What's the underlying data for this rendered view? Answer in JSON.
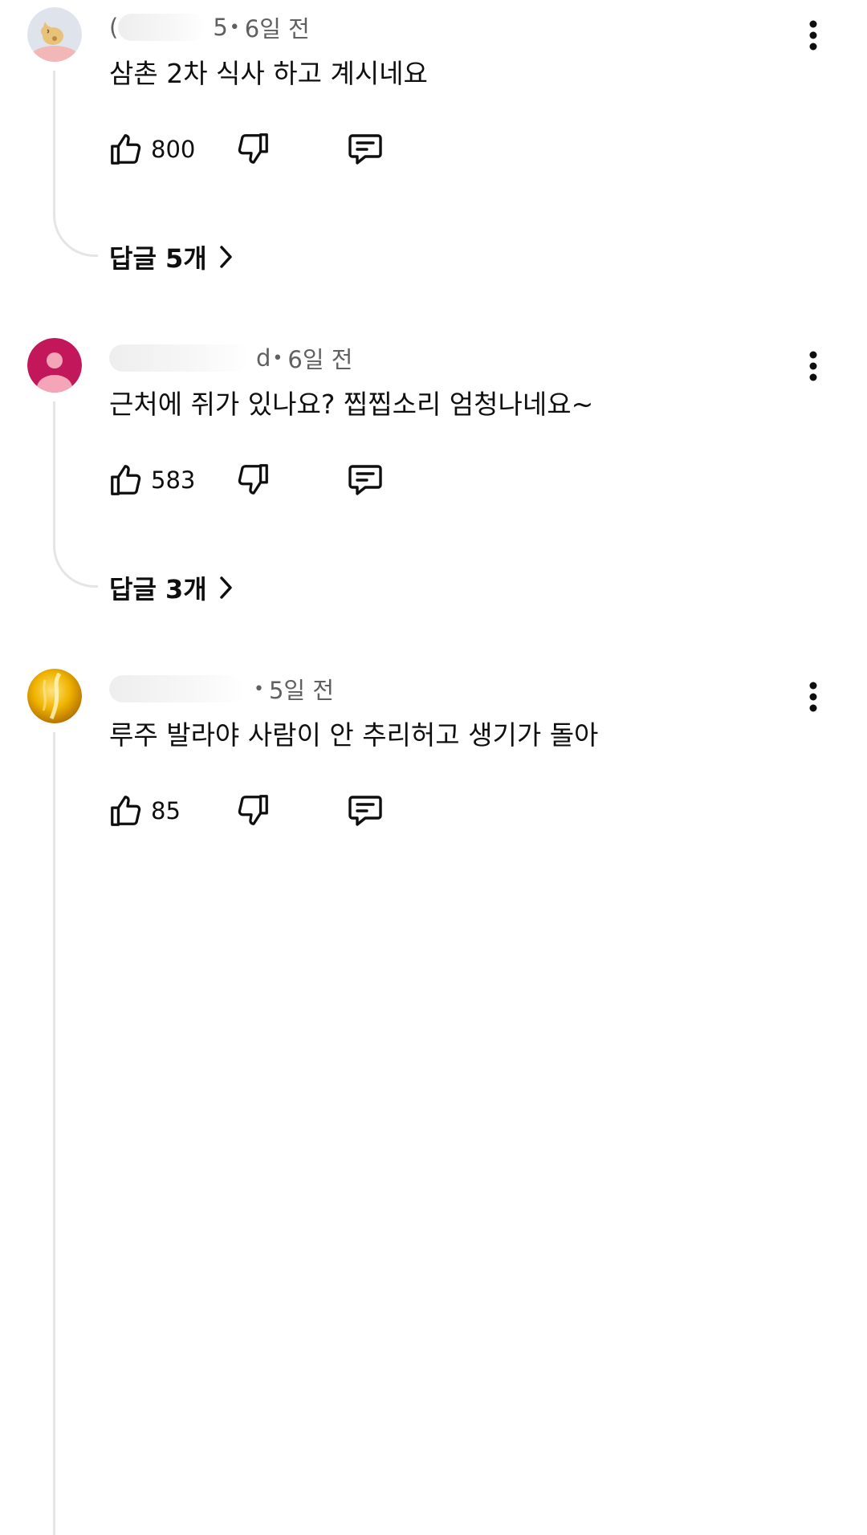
{
  "comments": [
    {
      "avatar": {
        "icon": "cat-avatar-icon",
        "bg": "#dfe4ec"
      },
      "author_visible": "(",
      "author_suffix": "5",
      "time": "6일 전",
      "text": "삼촌 2차 식사 하고 계시네요",
      "likes": "800",
      "replies_label": "답글 5개"
    },
    {
      "avatar": {
        "icon": "default-user-icon",
        "bg": "#c2185b"
      },
      "author_visible": "",
      "author_suffix": "d",
      "time": "6일 전",
      "text": "근처에 쥐가 있나요? 찝찝소리 엄청나네요~",
      "likes": "583",
      "replies_label": "답글 3개"
    },
    {
      "avatar": {
        "icon": "gold-avatar-icon",
        "bg": "#e6a100"
      },
      "author_visible": "",
      "author_suffix": "",
      "time": "5일 전",
      "text": "루주 발라야 사람이 안 추리허고 생기가 돌아",
      "likes": "85",
      "replies_label": ""
    }
  ],
  "separator": "•",
  "colors": {
    "text_primary": "#0f0f0f",
    "text_secondary": "#606060",
    "thread_line": "#e5e5e5"
  }
}
